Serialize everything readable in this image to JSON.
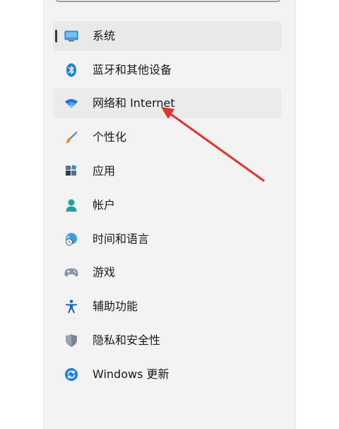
{
  "sidebar": {
    "items": [
      {
        "label": "系统",
        "icon": "display-icon"
      },
      {
        "label": "蓝牙和其他设备",
        "icon": "bluetooth-icon"
      },
      {
        "label": "网络和 Internet",
        "icon": "wifi-icon"
      },
      {
        "label": "个性化",
        "icon": "paintbrush-icon"
      },
      {
        "label": "应用",
        "icon": "apps-icon"
      },
      {
        "label": "帐户",
        "icon": "account-icon"
      },
      {
        "label": "时间和语言",
        "icon": "globe-clock-icon"
      },
      {
        "label": "游戏",
        "icon": "gamepad-icon"
      },
      {
        "label": "辅助功能",
        "icon": "accessibility-icon"
      },
      {
        "label": "隐私和安全性",
        "icon": "shield-icon"
      },
      {
        "label": "Windows 更新",
        "icon": "windows-update-icon"
      }
    ],
    "selected_index": 0,
    "hovered_index": 2
  },
  "annotation": {
    "arrow_color": "#e8322a"
  },
  "colors": {
    "accent_blue": "#0f6cbd",
    "panel_bg": "#f3f3f3"
  }
}
